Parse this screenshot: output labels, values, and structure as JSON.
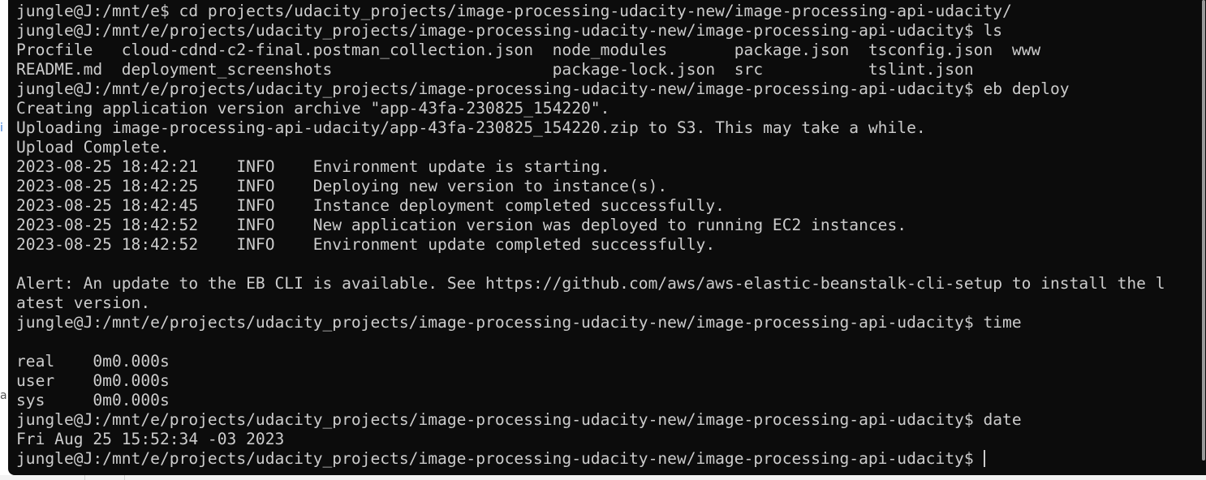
{
  "background": {
    "fragment_1": "i",
    "fragment_2": "a"
  },
  "terminal": {
    "lines": [
      "jungle@J:/mnt/e$ cd projects/udacity_projects/image-processing-udacity-new/image-processing-api-udacity/",
      "jungle@J:/mnt/e/projects/udacity_projects/image-processing-udacity-new/image-processing-api-udacity$ ls",
      "Procfile   cloud-cdnd-c2-final.postman_collection.json  node_modules       package.json  tsconfig.json  www",
      "README.md  deployment_screenshots                       package-lock.json  src           tslint.json",
      "jungle@J:/mnt/e/projects/udacity_projects/image-processing-udacity-new/image-processing-api-udacity$ eb deploy",
      "Creating application version archive \"app-43fa-230825_154220\".",
      "Uploading image-processing-api-udacity/app-43fa-230825_154220.zip to S3. This may take a while.",
      "Upload Complete.",
      "2023-08-25 18:42:21    INFO    Environment update is starting.",
      "2023-08-25 18:42:25    INFO    Deploying new version to instance(s).",
      "2023-08-25 18:42:45    INFO    Instance deployment completed successfully.",
      "2023-08-25 18:42:52    INFO    New application version was deployed to running EC2 instances.",
      "2023-08-25 18:42:52    INFO    Environment update completed successfully.",
      "",
      "Alert: An update to the EB CLI is available. See https://github.com/aws/aws-elastic-beanstalk-cli-setup to install the l",
      "atest version.",
      "jungle@J:/mnt/e/projects/udacity_projects/image-processing-udacity-new/image-processing-api-udacity$ time",
      "",
      "real    0m0.000s",
      "user    0m0.000s",
      "sys     0m0.000s",
      "jungle@J:/mnt/e/projects/udacity_projects/image-processing-udacity-new/image-processing-api-udacity$ date",
      "Fri Aug 25 15:52:34 -03 2023"
    ],
    "prompt": "jungle@J:/mnt/e/projects/udacity_projects/image-processing-udacity-new/image-processing-api-udacity$",
    "colors": {
      "background": "#0c0c0c",
      "foreground": "#cccccc"
    }
  }
}
